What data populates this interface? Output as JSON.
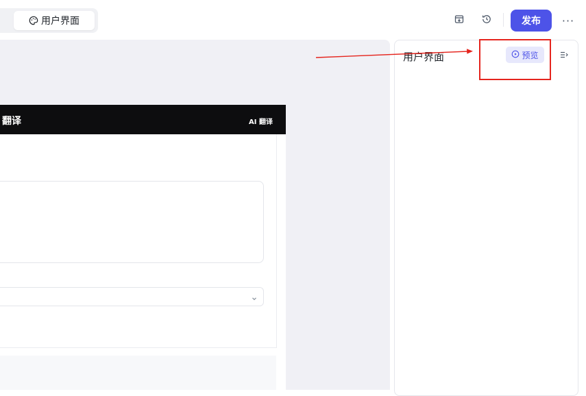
{
  "toolbar": {
    "ui_tab_label": "用户界面",
    "publish_label": "发布",
    "more_label": "···"
  },
  "canvas": {
    "app_title": "翻译",
    "app_badge": "AI 翻译"
  },
  "side_panel": {
    "title": "用户界面",
    "preview_label": "预览"
  },
  "colors": {
    "primary": "#4d53e8",
    "preview_bg": "#e7e8fc",
    "canvas_bg": "#f0f0f5",
    "app_header_bg": "#0d0d0f",
    "annotation": "#e5241d"
  },
  "icons": {
    "ui_tab": "palette-icon",
    "save": "archive-download-icon",
    "history": "history-icon",
    "preview": "play-circle-icon",
    "collapse": "panel-collapse-icon",
    "select": "chevron-down-icon"
  }
}
